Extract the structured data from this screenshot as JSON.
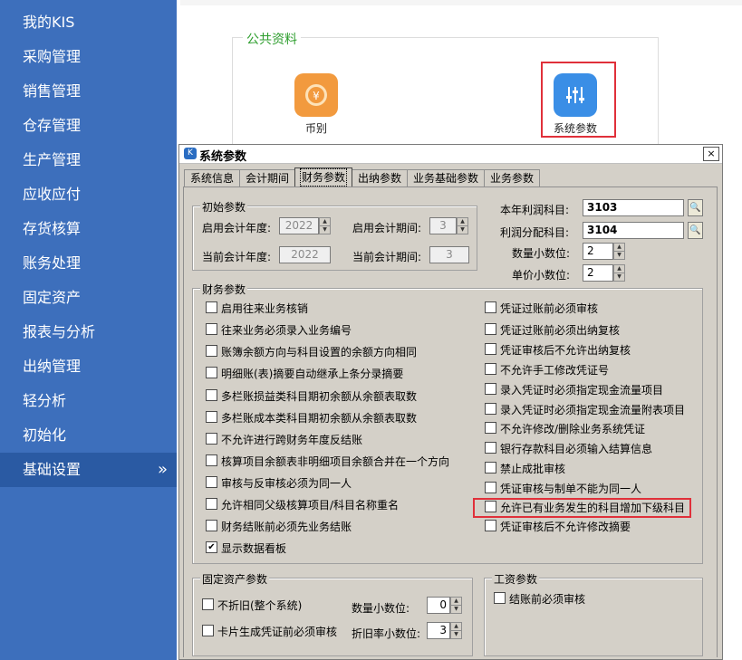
{
  "sidebar": {
    "items": [
      {
        "label": "我的KIS"
      },
      {
        "label": "采购管理"
      },
      {
        "label": "销售管理"
      },
      {
        "label": "仓存管理"
      },
      {
        "label": "生产管理"
      },
      {
        "label": "应收应付"
      },
      {
        "label": "存货核算"
      },
      {
        "label": "账务处理"
      },
      {
        "label": "固定资产"
      },
      {
        "label": "报表与分析"
      },
      {
        "label": "出纳管理"
      },
      {
        "label": "轻分析"
      },
      {
        "label": "初始化"
      },
      {
        "label": "基础设置",
        "active": true,
        "arrow": "»"
      }
    ]
  },
  "public_data": {
    "title": "公共资料",
    "tiles": [
      {
        "label": "币别",
        "icon": "currency-icon",
        "color": "#f29a3e"
      },
      {
        "label": "系统参数",
        "icon": "settings-sliders-icon",
        "color": "#3a8ee6"
      }
    ]
  },
  "dialog": {
    "title": "系统参数",
    "close_glyph": "×",
    "tabs": [
      "系统信息",
      "会计期间",
      "财务参数",
      "出纳参数",
      "业务基础参数",
      "业务参数"
    ],
    "active_tab": "财务参数",
    "initial": {
      "title": "初始参数",
      "start_year_label": "启用会计年度:",
      "start_year": "2022",
      "start_period_label": "启用会计期间:",
      "start_period": "3",
      "current_year_label": "当前会计年度:",
      "current_year": "2022",
      "current_period_label": "当前会计期间:",
      "current_period": "3"
    },
    "accounts": {
      "profit_label": "本年利润科目:",
      "profit_value": "3103",
      "distribution_label": "利润分配科目:",
      "distribution_value": "3104",
      "qty_decimals_label": "数量小数位:",
      "qty_decimals": "2",
      "price_decimals_label": "单价小数位:",
      "price_decimals": "2"
    },
    "finance": {
      "title": "财务参数",
      "left": [
        {
          "label": "启用往来业务核销",
          "checked": false
        },
        {
          "label": "往来业务必须录入业务编号",
          "checked": false
        },
        {
          "label": "账簿余额方向与科目设置的余额方向相同",
          "checked": false
        },
        {
          "label": "明细账(表)摘要自动继承上条分录摘要",
          "checked": false
        },
        {
          "label": "多栏账损益类科目期初余额从余额表取数",
          "checked": false
        },
        {
          "label": "多栏账成本类科目期初余额从余额表取数",
          "checked": false
        },
        {
          "label": "不允许进行跨财务年度反结账",
          "checked": false
        },
        {
          "label": "核算项目余额表非明细项目余额合并在一个方向",
          "checked": false
        },
        {
          "label": "审核与反审核必须为同一人",
          "checked": false
        },
        {
          "label": "允许相同父级核算项目/科目名称重名",
          "checked": false
        },
        {
          "label": "财务结账前必须先业务结账",
          "checked": false
        },
        {
          "label": "显示数据看板",
          "checked": true
        }
      ],
      "right": [
        {
          "label": "凭证过账前必须审核",
          "checked": false
        },
        {
          "label": "凭证过账前必须出纳复核",
          "checked": false
        },
        {
          "label": "凭证审核后不允许出纳复核",
          "checked": false
        },
        {
          "label": "不允许手工修改凭证号",
          "checked": false
        },
        {
          "label": "录入凭证时必须指定现金流量项目",
          "checked": false
        },
        {
          "label": "录入凭证时必须指定现金流量附表项目",
          "checked": false
        },
        {
          "label": "不允许修改/删除业务系统凭证",
          "checked": false
        },
        {
          "label": "银行存款科目必须输入结算信息",
          "checked": false
        },
        {
          "label": "禁止成批审核",
          "checked": false
        },
        {
          "label": "凭证审核与制单不能为同一人",
          "checked": false
        },
        {
          "label": "允许已有业务发生的科目增加下级科目",
          "checked": false
        },
        {
          "label": "凭证审核后不允许修改摘要",
          "checked": false
        }
      ]
    },
    "fixed_assets": {
      "title": "固定资产参数",
      "no_depreciation_label": "不折旧(整个系统)",
      "no_depreciation": false,
      "card_voucher_label": "卡片生成凭证前必须审核",
      "card_voucher": false,
      "qty_decimals_label": "数量小数位:",
      "qty_decimals": "0",
      "rate_decimals_label": "折旧率小数位:",
      "rate_decimals": "3"
    },
    "salary": {
      "title": "工资参数",
      "audit_before_close_label": "结账前必须审核",
      "audit_before_close": false
    }
  }
}
